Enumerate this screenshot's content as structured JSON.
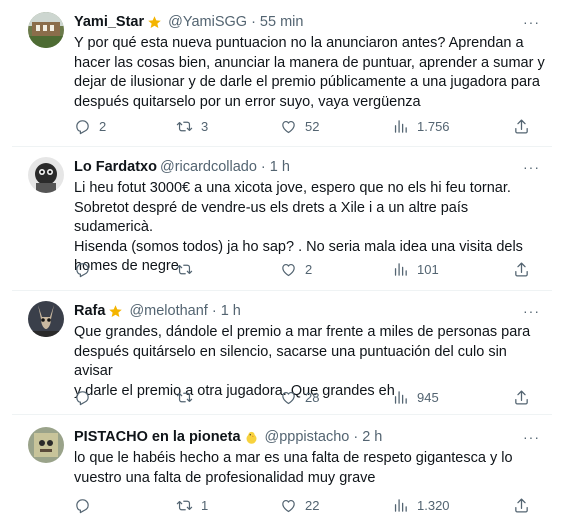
{
  "tweets": [
    {
      "name": "Yami_Star",
      "badge": "star",
      "handle": "@YamiSGG",
      "time": "55 min",
      "text": "Y por qué esta nueva puntuacion no la anunciaron antes? Aprendan a\nhacer las cosas bien, anunciar la manera de puntuar, aprender a sumar y\ndejar de ilusionar y de darle el premio públicamente a una jugadora para\ndespués quitarselo por un error suyo, vaya vergüenza",
      "replies": "2",
      "retweets": "3",
      "likes": "52",
      "views": "1.756"
    },
    {
      "name": "Lo Fardatxo",
      "badge": "",
      "handle": "@ricardcollado",
      "time": "1 h",
      "text": "Li heu fotut 3000€ a una xicota jove, espero que no els hi feu tornar.\nSobretot despré de vendre-us els drets a Xile i a un altre país sudamericà.\nHisenda (somos todos) ja ho sap? . No seria mala idea una visita dels\nhomes de negre",
      "replies": "",
      "retweets": "",
      "likes": "2",
      "views": "101"
    },
    {
      "name": "Rafa",
      "badge": "star",
      "handle": "@melothanf",
      "time": "1 h",
      "text": "Que grandes, dándole el premio a mar frente a miles de personas para\ndespués quitárselo en silencio, sacarse una puntuación del culo sin avisar\ny darle el premio a otra jugadora. Que grandes eh",
      "replies": "",
      "retweets": "",
      "likes": "28",
      "views": "945"
    },
    {
      "name": "PISTACHO en la pioneta",
      "badge": "chick",
      "handle": "@pppistacho",
      "time": "2 h",
      "text": "lo que le habéis hecho a mar es una falta de respeto gigantesca y lo\nvuestro una falta de profesionalidad muy grave",
      "replies": "",
      "retweets": "1",
      "likes": "22",
      "views": "1.320"
    }
  ],
  "colors": {
    "text": "#0f1419",
    "secondary": "#536471",
    "divider": "#eff3f4",
    "star": "#f4b400"
  },
  "icons": {
    "reply": "reply-icon",
    "retweet": "retweet-icon",
    "like": "heart-icon",
    "views": "views-icon",
    "share": "share-icon",
    "more": "more-icon"
  }
}
